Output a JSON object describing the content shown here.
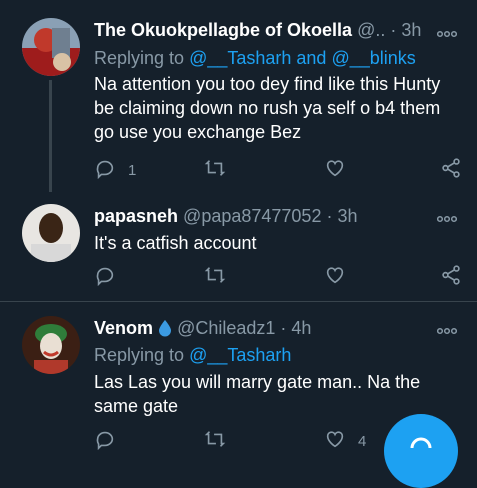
{
  "tweets": [
    {
      "name": "The Okuokpellagbe of Okoella",
      "handle": "@..",
      "dot": "·",
      "time": "3h",
      "replying_prefix": "Replying to",
      "replying_mentions": "@__Tasharh and @__blinks",
      "text_lines": [
        "Na attention you too dey find like this Hunty",
        "be claiming down no rush ya self o b4 them",
        "go use you exchange Bez"
      ],
      "reply_count": "1",
      "retweet_count": "",
      "like_count": "",
      "avatar": "avatar-photo-red"
    },
    {
      "name": "papasneh",
      "handle": "@papa87477052",
      "dot": "·",
      "time": "3h",
      "text_lines": [
        "It's a catfish account"
      ],
      "reply_count": "",
      "retweet_count": "",
      "like_count": "",
      "avatar": "avatar-photo-man"
    },
    {
      "name": "Venom",
      "name_emoji": "droplet-icon",
      "handle": "@Chileadz1",
      "dot": "·",
      "time": "4h",
      "replying_prefix": "Replying to",
      "replying_mentions": "@__Tasharh",
      "text_lines": [
        "Las Las you will marry gate man.. Na the",
        "same gate"
      ],
      "reply_count": "",
      "retweet_count": "",
      "like_count": "4",
      "avatar": "avatar-joker"
    }
  ],
  "icons": {
    "more": "more-icon",
    "reply": "reply-icon",
    "retweet": "retweet-icon",
    "like": "like-icon",
    "share": "share-icon",
    "compose": "compose-icon"
  },
  "colors": {
    "background": "#15202b",
    "divider": "#38444d",
    "secondary_text": "#8899a6",
    "accent": "#1da1f2"
  }
}
